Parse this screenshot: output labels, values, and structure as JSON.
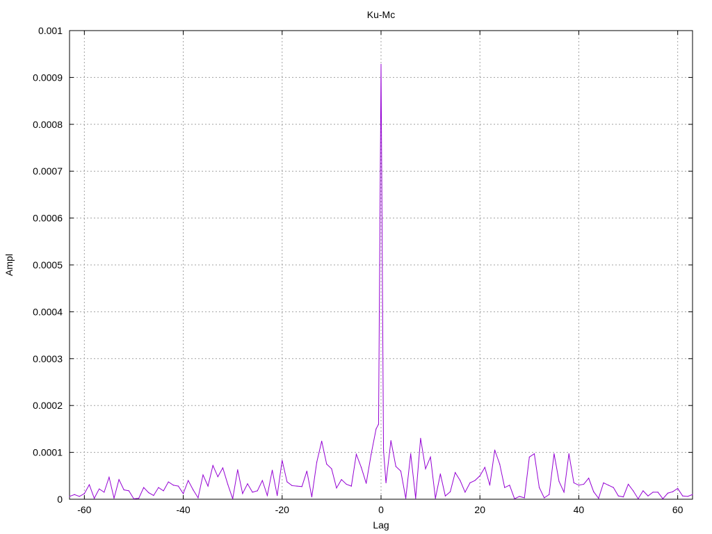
{
  "chart_data": {
    "type": "line",
    "title": "Ku-Mc",
    "xlabel": "Lag",
    "ylabel": "Ampl",
    "xlim": [
      -63,
      63
    ],
    "ylim": [
      0,
      0.001
    ],
    "grid": true,
    "x_ticks": [
      -60,
      -40,
      -20,
      0,
      20,
      40,
      60
    ],
    "x_tick_labels": [
      "-60",
      "-40",
      "-20",
      "0",
      "20",
      "40",
      "60"
    ],
    "y_ticks": [
      0,
      0.0001,
      0.0002,
      0.0003,
      0.0004,
      0.0005,
      0.0006,
      0.0007,
      0.0008,
      0.0009,
      0.001
    ],
    "y_tick_labels": [
      "0",
      "0.0001",
      "0.0002",
      "0.0003",
      "0.0004",
      "0.0005",
      "0.0006",
      "0.0007",
      "0.0008",
      "0.0009",
      "0.001"
    ],
    "series": [
      {
        "color": "#9400d3",
        "x": [
          -63,
          -62,
          -61,
          -60,
          -59,
          -58,
          -57,
          -56,
          -55,
          -54,
          -53,
          -52,
          -51,
          -50,
          -49,
          -48,
          -47,
          -46,
          -45,
          -44,
          -43,
          -42,
          -41,
          -40,
          -39,
          -38,
          -37,
          -36,
          -35,
          -34,
          -33,
          -32,
          -31,
          -30,
          -29,
          -28,
          -27,
          -26,
          -25,
          -24,
          -23,
          -22,
          -21,
          -20,
          -19,
          -18,
          -17,
          -16,
          -15,
          -14,
          -13,
          -12,
          -11,
          -10,
          -9,
          -8,
          -7,
          -6,
          -5,
          -4,
          -3,
          -2,
          -1,
          -0.5,
          0,
          0.5,
          1,
          2,
          3,
          4,
          5,
          6,
          7,
          8,
          9,
          10,
          11,
          12,
          13,
          14,
          15,
          16,
          17,
          18,
          19,
          20,
          21,
          22,
          23,
          24,
          25,
          26,
          27,
          28,
          29,
          30,
          31,
          32,
          33,
          34,
          35,
          36,
          37,
          38,
          39,
          40,
          41,
          42,
          43,
          44,
          45,
          46,
          47,
          48,
          49,
          50,
          51,
          52,
          53,
          54,
          55,
          56,
          57,
          58,
          59,
          60,
          61,
          62,
          63
        ],
        "values": [
          6e-06,
          1e-05,
          6e-06,
          1.2e-05,
          3.1e-05,
          2e-06,
          2.2e-05,
          1.5e-05,
          4.7e-05,
          2e-06,
          4.2e-05,
          2e-05,
          1.8e-05,
          1e-06,
          2e-06,
          2.5e-05,
          1.4e-05,
          8e-06,
          2.5e-05,
          1.8e-05,
          3.7e-05,
          3e-05,
          2.8e-05,
          1.2e-05,
          4e-05,
          2e-05,
          3e-06,
          5.2e-05,
          2.8e-05,
          7.2e-05,
          4.8e-05,
          6.7e-05,
          3.2e-05,
          1e-06,
          6.3e-05,
          1.2e-05,
          3.3e-05,
          1.5e-05,
          1.8e-05,
          4e-05,
          8e-06,
          6.2e-05,
          8e-06,
          8.3e-05,
          3.7e-05,
          2.9e-05,
          2.8e-05,
          2.7e-05,
          6e-05,
          5e-06,
          7.9e-05,
          0.000124,
          7.5e-05,
          6.5e-05,
          2.4e-05,
          4.2e-05,
          3.2e-05,
          2.8e-05,
          9.6e-05,
          6.8e-05,
          3.4e-05,
          9.6e-05,
          0.00015,
          0.00016,
          0.000928,
          0.000105,
          3.5e-05,
          0.000125,
          7e-05,
          6e-05,
          2e-06,
          9.7e-05,
          2e-06,
          0.00013,
          6.5e-05,
          9e-05,
          2e-06,
          5.4e-05,
          7e-06,
          1.6e-05,
          5.7e-05,
          4e-05,
          1.5e-05,
          3.5e-05,
          4e-05,
          5e-05,
          6.8e-05,
          3e-05,
          0.000105,
          7.5e-05,
          2.5e-05,
          3e-05,
          1e-06,
          6e-06,
          3e-06,
          9e-05,
          9.7e-05,
          2.5e-05,
          3e-06,
          1e-05,
          9.7e-05,
          3.8e-05,
          1.5e-05,
          9.7e-05,
          3.5e-05,
          3e-05,
          3.2e-05,
          4.5e-05,
          1.6e-05,
          2e-06,
          3.5e-05,
          3e-05,
          2.5e-05,
          7e-06,
          5e-06,
          3.2e-05,
          1.8e-05,
          1e-06,
          1.8e-05,
          7e-06,
          1.5e-05,
          1.5e-05,
          1e-06,
          1.3e-05,
          1.6e-05,
          2.3e-05,
          7e-06,
          6e-06,
          1e-05
        ]
      }
    ]
  }
}
